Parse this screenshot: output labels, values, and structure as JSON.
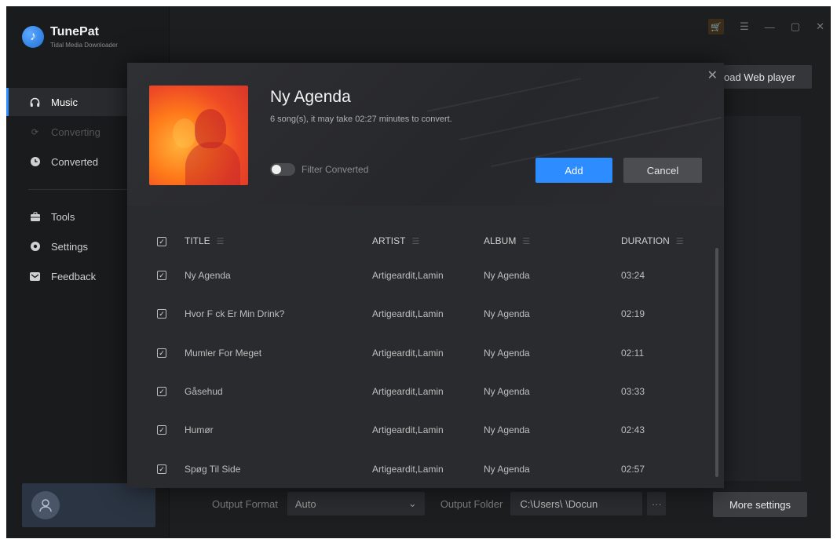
{
  "app": {
    "name": "TunePat",
    "subtitle": "Tidal Media Downloader"
  },
  "sidebar": {
    "items": [
      {
        "label": "Music",
        "icon": "headphones-icon"
      },
      {
        "label": "Converting",
        "icon": "sync-icon"
      },
      {
        "label": "Converted",
        "icon": "clock-icon"
      },
      {
        "label": "Tools",
        "icon": "toolbox-icon"
      },
      {
        "label": "Settings",
        "icon": "gear-icon"
      },
      {
        "label": "Feedback",
        "icon": "mail-icon"
      }
    ]
  },
  "header": {
    "load_web_player": "oad Web player"
  },
  "bottom": {
    "output_format_label": "Output Format",
    "output_format_value": "Auto",
    "output_folder_label": "Output Folder",
    "output_folder_value": "C:\\Users\\          \\Docun",
    "dots": "···",
    "more_settings": "More settings"
  },
  "modal": {
    "title": "Ny Agenda",
    "subtitle": "6 song(s), it may take 02:27 minutes to convert.",
    "filter_label": "Filter Converted",
    "add_label": "Add",
    "cancel_label": "Cancel",
    "close": "✕",
    "columns": [
      "TITLE",
      "ARTIST",
      "ALBUM",
      "DURATION"
    ],
    "rows": [
      {
        "title": "Ny Agenda",
        "artist": "Artigeardit,Lamin",
        "album": "Ny Agenda",
        "duration": "03:24"
      },
      {
        "title": "Hvor F  ck Er Min Drink?",
        "artist": "Artigeardit,Lamin",
        "album": "Ny Agenda",
        "duration": "02:19"
      },
      {
        "title": "Mumler For Meget",
        "artist": "Artigeardit,Lamin",
        "album": "Ny Agenda",
        "duration": "02:11"
      },
      {
        "title": "Gåsehud",
        "artist": "Artigeardit,Lamin",
        "album": "Ny Agenda",
        "duration": "03:33"
      },
      {
        "title": "Humør",
        "artist": "Artigeardit,Lamin",
        "album": "Ny Agenda",
        "duration": "02:43"
      },
      {
        "title": "Spøg Til Side",
        "artist": "Artigeardit,Lamin",
        "album": "Ny Agenda",
        "duration": "02:57"
      }
    ]
  },
  "colors": {
    "accent": "#2d8cff",
    "background": "#1d1e20",
    "modal": "#2a2b2e"
  }
}
